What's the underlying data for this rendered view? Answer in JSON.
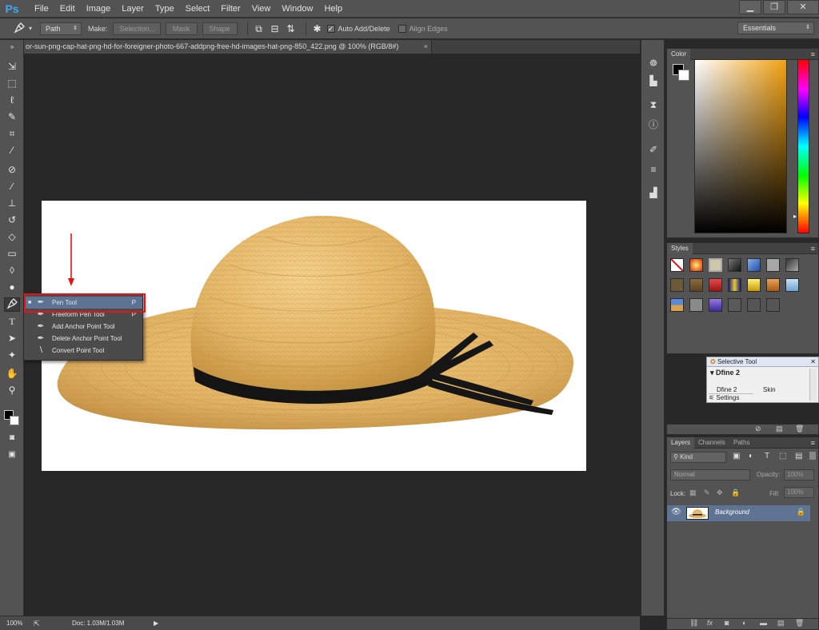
{
  "app": {
    "logo": "Ps"
  },
  "menu": [
    "File",
    "Edit",
    "Image",
    "Layer",
    "Type",
    "Select",
    "Filter",
    "View",
    "Window",
    "Help"
  ],
  "window_controls": {
    "minimize": "▁",
    "restore": "❐",
    "close": "✕"
  },
  "options": {
    "tool_mode": "Path",
    "make_label": "Make:",
    "selection_btn": "Selection...",
    "mask_btn": "Mask",
    "shape_btn": "Shape",
    "auto_add_delete": "Auto Add/Delete",
    "align_edges": "Align Edges",
    "workspace": "Essentials"
  },
  "document": {
    "tab_title": "or-sun-png-cap-hat-png-hd-for-foreigner-photo-667-addpng-free-hd-images-hat-png-850_422.png @ 100% (RGB/8#)",
    "tab_close": "×"
  },
  "flyout": {
    "items": [
      {
        "label": "Pen Tool",
        "shortcut": "P",
        "icon": "pen-icon",
        "selected": true
      },
      {
        "label": "Freeform Pen Tool",
        "shortcut": "P",
        "icon": "freeform-pen-icon",
        "selected": false
      },
      {
        "label": "Add Anchor Point Tool",
        "shortcut": "",
        "icon": "add-anchor-icon",
        "selected": false
      },
      {
        "label": "Delete Anchor Point Tool",
        "shortcut": "",
        "icon": "delete-anchor-icon",
        "selected": false
      },
      {
        "label": "Convert Point Tool",
        "shortcut": "",
        "icon": "convert-point-icon",
        "selected": false
      }
    ]
  },
  "panels": {
    "color": {
      "tab": "Color"
    },
    "styles": {
      "tab": "Styles"
    },
    "selective_tool": {
      "title": "Selective Tool",
      "preset": "Dfine 2",
      "cols": [
        "Dfine 2",
        "Skin"
      ],
      "settings": "Settings"
    },
    "layers": {
      "tabs": [
        "Layers",
        "Channels",
        "Paths"
      ],
      "filter": "Kind",
      "blend_mode": "Normal",
      "opacity_label": "Opacity:",
      "opacity_value": "100%",
      "lock_label": "Lock:",
      "fill_label": "Fill:",
      "fill_value": "100%",
      "layer_name": "Background"
    }
  },
  "status": {
    "zoom": "100%",
    "doc": "Doc: 1.03M/1.03M"
  },
  "colors": {
    "accent_selection": "#5d7394",
    "highlight_box": "#e31414",
    "ui_bg": "#535353"
  }
}
